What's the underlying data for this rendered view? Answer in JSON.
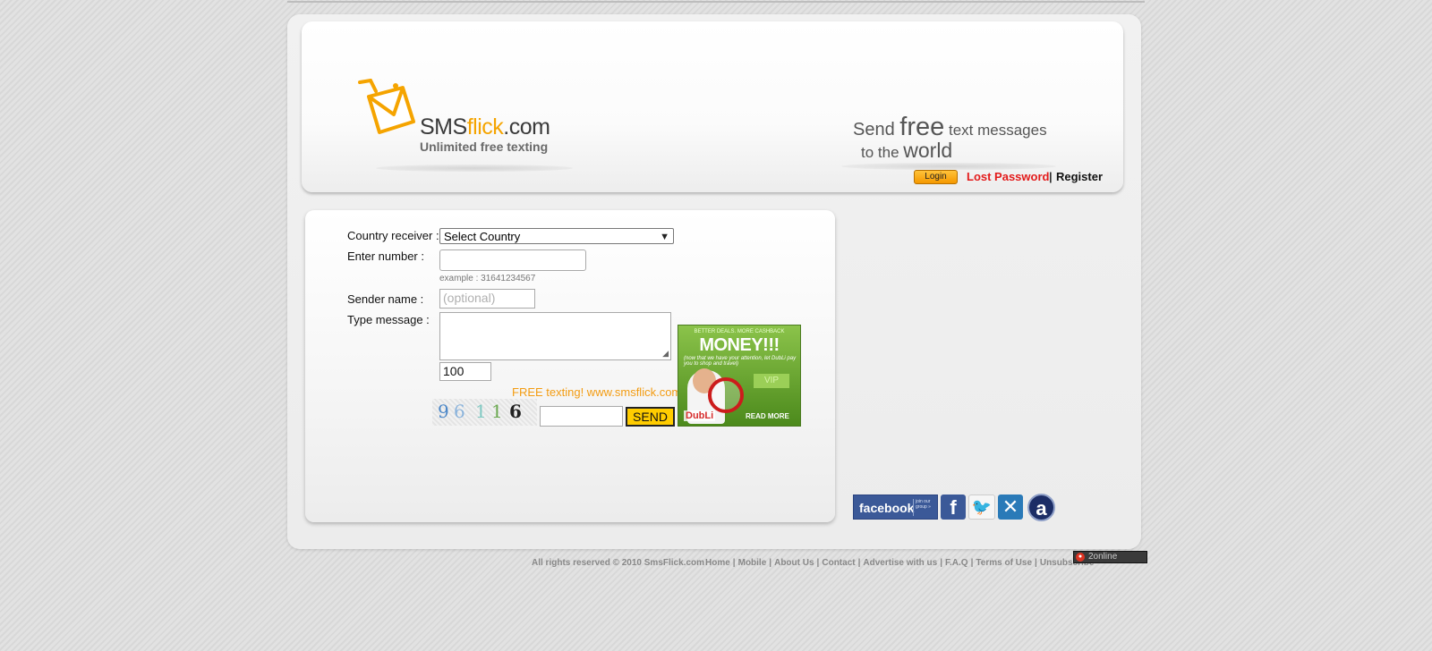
{
  "header": {
    "logo": {
      "name_prefix": "SMS",
      "name_accent": "flick",
      "name_suffix": ".com",
      "tagline": "Unlimited free texting",
      "icon": "envelope-cart-icon"
    },
    "slogan": {
      "line1_a": "Send ",
      "line1_big": "free",
      "line1_b": " text messages",
      "line2_a": "to the ",
      "line2_big": "world"
    },
    "login_label": "Login",
    "lost_password_label": "Lost Password",
    "separator": "|",
    "register_label": "Register"
  },
  "form": {
    "country_label": "Country receiver :",
    "country_selected": "Select Country",
    "number_label": "Enter number :",
    "number_value": "",
    "number_hint": "example : 31641234567",
    "sender_label": "Sender name :",
    "sender_placeholder": "(optional)",
    "message_label": "Type message :",
    "message_value": "",
    "char_count": "100",
    "promo_text": "FREE texting! www.smsflick.com",
    "captcha_digits": [
      "9",
      "6",
      "1",
      "1",
      "6"
    ],
    "captcha_value": "",
    "send_label": "SEND"
  },
  "ad": {
    "top_text": "BETTER DEALS. MORE CASHBACK",
    "headline": "MONEY!!!",
    "sub_text": "(now that we have your attention, let DubLi pay you to shop and travel)",
    "vip": "VIP",
    "brand": "DubLi",
    "cta": "READ MORE"
  },
  "social": {
    "facebook_group_label": "facebook",
    "facebook_group_sub": "join our group »",
    "facebook_icon": "f",
    "twitter_icon": "🐦",
    "delicious_icon": "✕",
    "amazon_icon": "a"
  },
  "footer": {
    "copyright": "All rights reserved © 2010 SmsFlick.com",
    "links": [
      "Home",
      "Mobile",
      "About Us",
      "Contact",
      "Advertise with us",
      "F.A.Q",
      "Terms of Use",
      "Unsubscribe"
    ],
    "counter_text": "2online"
  },
  "colors": {
    "accent": "#f5a400",
    "lost_password": "#e31b1b",
    "send_button": "#ffcc00",
    "facebook": "#3b5998"
  }
}
